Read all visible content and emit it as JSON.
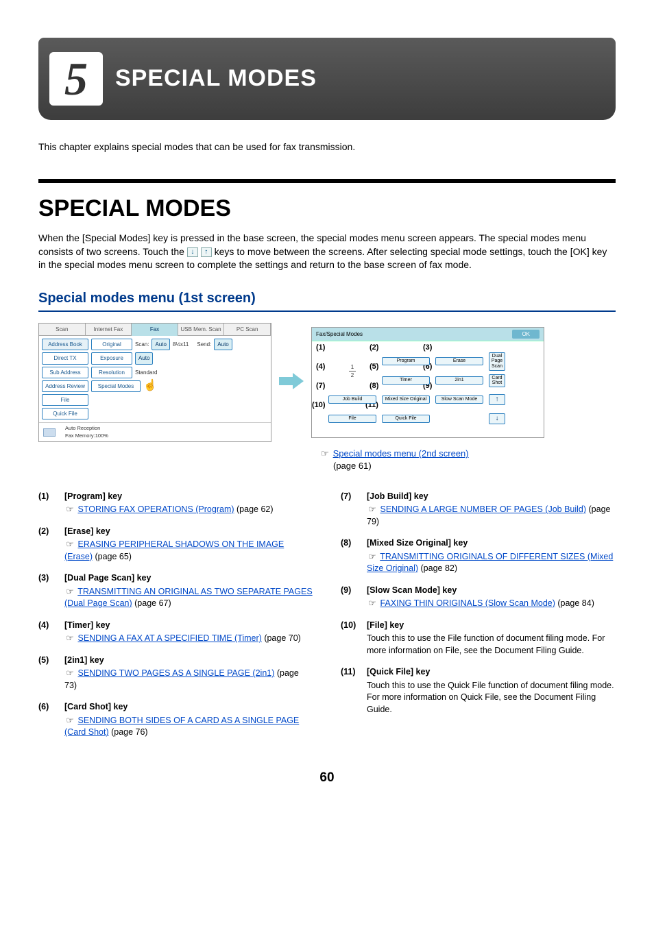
{
  "banner": {
    "number": "5",
    "title": "SPECIAL MODES"
  },
  "intro": "This chapter explains special modes that can be used for fax transmission.",
  "section": {
    "title": "SPECIAL MODES",
    "body_pre": "When the [Special Modes] key is pressed in the base screen, the special modes menu screen appears. The special modes menu consists of two screens. Touch the ",
    "body_post": " keys to move between the screens. After selecting special mode settings, touch the [OK] key in the special modes menu screen to complete the settings and return to the base screen of fax mode."
  },
  "subhead": "Special modes menu (1st screen)",
  "scr1": {
    "tabs": [
      "Scan",
      "Internet Fax",
      "Fax",
      "USB Mem. Scan",
      "PC Scan"
    ],
    "left": [
      "Address Book",
      "Direct TX",
      "Sub Address",
      "Address Review",
      "File",
      "Quick File"
    ],
    "rows": {
      "original": "Original",
      "scan": "Scan:",
      "auto_size": "Auto",
      "paper": "8½x11",
      "send": "Send:",
      "auto": "Auto",
      "exposure": "Exposure",
      "exp_val": "Auto",
      "resolution": "Resolution",
      "res_val": "Standard",
      "special_modes": "Special Modes"
    },
    "footer": {
      "auto_recv": "Auto Reception",
      "mem": "Fax Memory:100%"
    }
  },
  "scr2": {
    "title": "Fax/Special Modes",
    "ok": "OK",
    "cells": {
      "program": "Program",
      "erase": "Erase",
      "dual_page": "Dual Page Scan",
      "timer": "Timer",
      "twoin1": "2in1",
      "card_shot": "Card Shot",
      "job_build": "Job Build",
      "mixed": "Mixed Size Original",
      "slow": "Slow Scan Mode",
      "file": "File",
      "quick_file": "Quick File"
    },
    "frac": "1\n2",
    "callouts": {
      "1": "(1)",
      "2": "(2)",
      "3": "(3)",
      "4": "(4)",
      "5": "(5)",
      "6": "(6)",
      "7": "(7)",
      "8": "(8)",
      "9": "(9)",
      "10": "(10)",
      "11": "(11)"
    }
  },
  "see_next": {
    "link": "Special modes menu (2nd screen)",
    "page": "(page 61)"
  },
  "items_left": [
    {
      "n": "(1)",
      "title": "[Program] key",
      "link": "STORING FAX OPERATIONS (Program)",
      "page": " (page 62)"
    },
    {
      "n": "(2)",
      "title": "[Erase] key",
      "link": "ERASING PERIPHERAL SHADOWS ON THE IMAGE (Erase)",
      "page": " (page 65)"
    },
    {
      "n": "(3)",
      "title": "[Dual Page Scan] key",
      "link": "TRANSMITTING AN ORIGINAL AS TWO SEPARATE PAGES (Dual Page Scan)",
      "page": " (page 67)"
    },
    {
      "n": "(4)",
      "title": "[Timer] key",
      "link": "SENDING A FAX AT A SPECIFIED TIME (Timer)",
      "page": " (page 70)"
    },
    {
      "n": "(5)",
      "title": "[2in1] key",
      "link": "SENDING TWO PAGES AS A SINGLE PAGE (2in1)",
      "page": " (page 73)"
    },
    {
      "n": "(6)",
      "title": "[Card Shot] key",
      "link": "SENDING BOTH SIDES OF A CARD AS A SINGLE PAGE (Card Shot)",
      "page": " (page 76)"
    }
  ],
  "items_right": [
    {
      "n": "(7)",
      "title": "[Job Build] key",
      "link": "SENDING A LARGE NUMBER OF PAGES (Job Build)",
      "page": " (page 79)"
    },
    {
      "n": "(8)",
      "title": "[Mixed Size Original] key",
      "link": "TRANSMITTING ORIGINALS OF DIFFERENT SIZES (Mixed Size Original)",
      "page": " (page 82)"
    },
    {
      "n": "(9)",
      "title": "[Slow Scan Mode] key",
      "link": "FAXING THIN ORIGINALS (Slow Scan Mode)",
      "page": " (page 84)"
    },
    {
      "n": "(10)",
      "title": "[File] key",
      "text": "Touch this to use the File function of document filing mode. For more information on File, see the Document Filing Guide."
    },
    {
      "n": "(11)",
      "title": "[Quick File] key",
      "text": "Touch this to use the Quick File function of document filing mode. For more information on Quick File, see the Document Filing Guide."
    }
  ],
  "page_number": "60"
}
